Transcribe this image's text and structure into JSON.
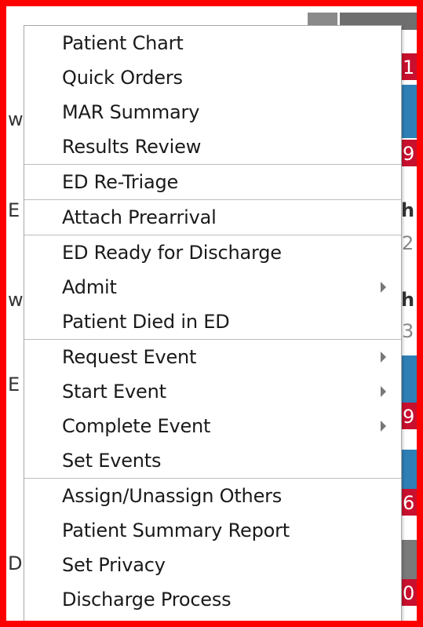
{
  "background": {
    "fragments": [
      "w",
      "E",
      "h",
      "2",
      "w",
      "h",
      "3",
      "E",
      "D",
      "1",
      "9",
      "9",
      "6",
      "0"
    ]
  },
  "menu": {
    "groups": [
      {
        "items": [
          {
            "label": "Patient Chart",
            "submenu": false
          },
          {
            "label": "Quick Orders",
            "submenu": false
          },
          {
            "label": "MAR Summary",
            "submenu": false
          },
          {
            "label": "Results Review",
            "submenu": false
          }
        ]
      },
      {
        "items": [
          {
            "label": "ED Re-Triage",
            "submenu": false
          }
        ]
      },
      {
        "items": [
          {
            "label": "Attach Prearrival",
            "submenu": false
          }
        ]
      },
      {
        "items": [
          {
            "label": "ED Ready for Discharge",
            "submenu": false
          },
          {
            "label": "Admit",
            "submenu": true
          },
          {
            "label": "Patient Died in ED",
            "submenu": false
          }
        ]
      },
      {
        "items": [
          {
            "label": "Request Event",
            "submenu": true
          },
          {
            "label": "Start Event",
            "submenu": true
          },
          {
            "label": "Complete Event",
            "submenu": true
          },
          {
            "label": "Set Events",
            "submenu": false
          }
        ]
      },
      {
        "items": [
          {
            "label": "Assign/Unassign Others",
            "submenu": false
          },
          {
            "label": "Patient Summary Report",
            "submenu": false
          },
          {
            "label": "Set Privacy",
            "submenu": false
          },
          {
            "label": "Discharge Process",
            "submenu": false
          }
        ]
      }
    ]
  },
  "colors": {
    "highlight_frame": "#ff0000",
    "menu_background": "#ffffff",
    "menu_text": "#1a1a1a",
    "separator": "#bdbdbd",
    "underlying_row_blue": "#2f7fb5",
    "underlying_badge_red": "#c8102e",
    "underlying_header_gray": "#7a7a7a"
  }
}
